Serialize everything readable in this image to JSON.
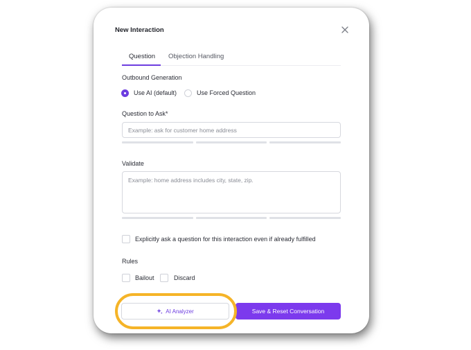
{
  "modal": {
    "title": "New Interaction"
  },
  "tabs": [
    {
      "label": "Question",
      "active": true
    },
    {
      "label": "Objection Handling",
      "active": false
    }
  ],
  "outbound": {
    "label": "Outbound Generation",
    "options": [
      {
        "label": "Use AI (default)",
        "selected": true
      },
      {
        "label": "Use Forced Question",
        "selected": false
      }
    ]
  },
  "question": {
    "label": "Question to Ask*",
    "placeholder": "Example: ask for customer home address",
    "value": ""
  },
  "validate": {
    "label": "Validate",
    "placeholder": "Example: home address includes city, state, zip.",
    "value": ""
  },
  "explicit": {
    "label": "Explicitly ask a question for this interaction even if already fulfilled",
    "checked": false
  },
  "rules": {
    "label": "Rules",
    "options": [
      {
        "label": "Bailout",
        "checked": false
      },
      {
        "label": "Discard",
        "checked": false
      }
    ]
  },
  "footer": {
    "analyzer_label": "AI Analyzer",
    "save_label": "Save & Reset Conversation"
  },
  "colors": {
    "accent": "#7c3aed",
    "highlight": "#f5b428"
  },
  "icons": {
    "close": "close-icon",
    "analyzer": "sparkle-icon"
  }
}
